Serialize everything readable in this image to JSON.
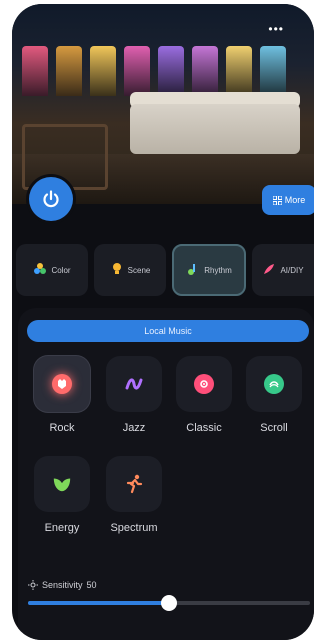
{
  "header": {
    "menu_glyph": "•••",
    "power_icon": "power-icon",
    "more_label": "More",
    "more_icon": "grid-icon"
  },
  "tabs": [
    {
      "label": "Color",
      "icon": "color-palette-icon",
      "active": false
    },
    {
      "label": "Scene",
      "icon": "scene-bulb-icon",
      "active": false
    },
    {
      "label": "Rhythm",
      "icon": "rhythm-music-icon",
      "active": true
    },
    {
      "label": "AI/DIY",
      "icon": "ai-diy-feather-icon",
      "active": false
    }
  ],
  "music": {
    "source_label": "Local Music",
    "modes": [
      {
        "label": "Rock",
        "icon": "rock-icon",
        "color": "#ff6b6b",
        "active": true
      },
      {
        "label": "Jazz",
        "icon": "jazz-icon",
        "color": "#b070ff",
        "active": false
      },
      {
        "label": "Classic",
        "icon": "classic-icon",
        "color": "#ff4f7a",
        "active": false
      },
      {
        "label": "Scroll",
        "icon": "scroll-icon",
        "color": "#37c98a",
        "active": false
      },
      {
        "label": "Energy",
        "icon": "energy-leaf-icon",
        "color": "#7fd85a",
        "active": false
      },
      {
        "label": "Spectrum",
        "icon": "spectrum-runner-icon",
        "color": "#ff8a5c",
        "active": false
      }
    ]
  },
  "sensitivity": {
    "label": "Sensitivity",
    "value": "50",
    "fraction": 0.5,
    "icon": "sun-icon"
  },
  "colors": {
    "accent": "#2f7fe0",
    "background": "#0d0e13"
  }
}
